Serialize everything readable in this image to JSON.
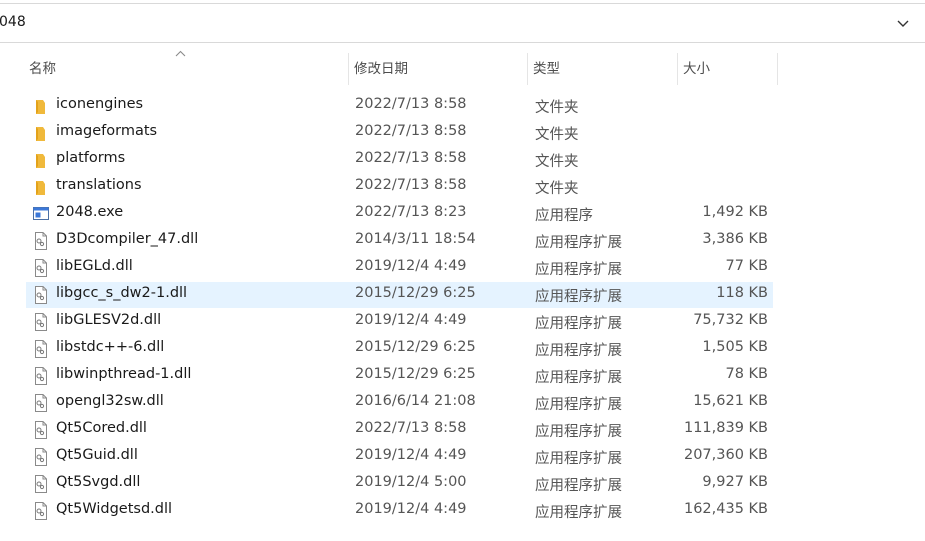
{
  "address": {
    "path": "048"
  },
  "columns": {
    "name": "名称",
    "date": "修改日期",
    "type": "类型",
    "size": "大小"
  },
  "selected_index": 7,
  "files": [
    {
      "name": "iconengines",
      "date": "2022/7/13 8:58",
      "type": "文件夹",
      "size": "",
      "icon": "folder-icon"
    },
    {
      "name": "imageformats",
      "date": "2022/7/13 8:58",
      "type": "文件夹",
      "size": "",
      "icon": "folder-icon"
    },
    {
      "name": "platforms",
      "date": "2022/7/13 8:58",
      "type": "文件夹",
      "size": "",
      "icon": "folder-icon"
    },
    {
      "name": "translations",
      "date": "2022/7/13 8:58",
      "type": "文件夹",
      "size": "",
      "icon": "folder-icon"
    },
    {
      "name": "2048.exe",
      "date": "2022/7/13 8:23",
      "type": "应用程序",
      "size": "1,492 KB",
      "icon": "exe-icon"
    },
    {
      "name": "D3Dcompiler_47.dll",
      "date": "2014/3/11 18:54",
      "type": "应用程序扩展",
      "size": "3,386 KB",
      "icon": "dll-icon"
    },
    {
      "name": "libEGLd.dll",
      "date": "2019/12/4 4:49",
      "type": "应用程序扩展",
      "size": "77 KB",
      "icon": "dll-icon"
    },
    {
      "name": "libgcc_s_dw2-1.dll",
      "date": "2015/12/29 6:25",
      "type": "应用程序扩展",
      "size": "118 KB",
      "icon": "dll-icon"
    },
    {
      "name": "libGLESV2d.dll",
      "date": "2019/12/4 4:49",
      "type": "应用程序扩展",
      "size": "75,732 KB",
      "icon": "dll-icon"
    },
    {
      "name": "libstdc++-6.dll",
      "date": "2015/12/29 6:25",
      "type": "应用程序扩展",
      "size": "1,505 KB",
      "icon": "dll-icon"
    },
    {
      "name": "libwinpthread-1.dll",
      "date": "2015/12/29 6:25",
      "type": "应用程序扩展",
      "size": "78 KB",
      "icon": "dll-icon"
    },
    {
      "name": "opengl32sw.dll",
      "date": "2016/6/14 21:08",
      "type": "应用程序扩展",
      "size": "15,621 KB",
      "icon": "dll-icon"
    },
    {
      "name": "Qt5Cored.dll",
      "date": "2022/7/13 8:58",
      "type": "应用程序扩展",
      "size": "111,839 KB",
      "icon": "dll-icon"
    },
    {
      "name": "Qt5Guid.dll",
      "date": "2019/12/4 4:49",
      "type": "应用程序扩展",
      "size": "207,360 KB",
      "icon": "dll-icon"
    },
    {
      "name": "Qt5Svgd.dll",
      "date": "2019/12/4 5:00",
      "type": "应用程序扩展",
      "size": "9,927 KB",
      "icon": "dll-icon"
    },
    {
      "name": "Qt5Widgetsd.dll",
      "date": "2019/12/4 4:49",
      "type": "应用程序扩展",
      "size": "162,435 KB",
      "icon": "dll-icon"
    }
  ]
}
